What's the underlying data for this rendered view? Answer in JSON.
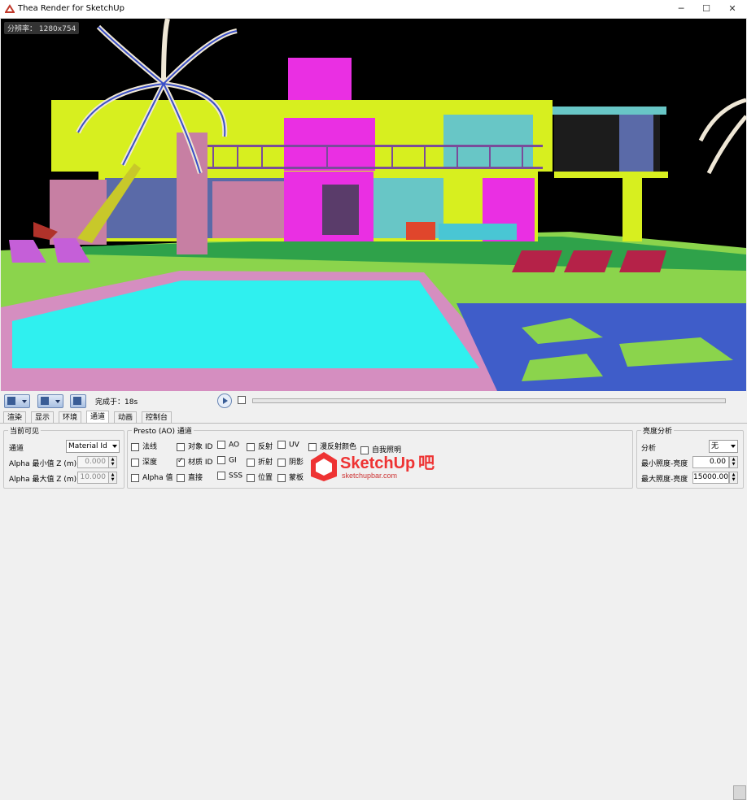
{
  "window": {
    "title": "Thea Render for SketchUp",
    "minimize": "─",
    "maximize": "☐",
    "close": "✕"
  },
  "viewport": {
    "resolution": "分辨率： 1280x754"
  },
  "toolbar": {
    "status": "完成于：18s"
  },
  "tabs": [
    "渲染",
    "显示",
    "环境",
    "通道",
    "动画",
    "控制台"
  ],
  "active_tab": "通道",
  "current_visible": {
    "title": "当前可见",
    "channel_label": "通道",
    "channel_value": "Material Id",
    "alpha_min_label": "Alpha 最小值 Z (m)",
    "alpha_min_value": "0.000",
    "alpha_max_label": "Alpha 最大值 Z (m)",
    "alpha_max_value": "10.000"
  },
  "presto": {
    "title": "Presto (AO) 通道",
    "checkboxes": [
      {
        "label": "法线",
        "checked": false
      },
      {
        "label": "对象 ID",
        "checked": false
      },
      {
        "label": "AO",
        "checked": false
      },
      {
        "label": "反射",
        "checked": false
      },
      {
        "label": "UV",
        "checked": false
      },
      {
        "label": "漫反射颜色",
        "checked": false
      },
      {
        "label": "深度",
        "checked": false
      },
      {
        "label": "材质 ID",
        "checked": true
      },
      {
        "label": "GI",
        "checked": false
      },
      {
        "label": "折射",
        "checked": false
      },
      {
        "label": "阴影",
        "checked": false
      },
      {
        "label": "Alpha 值",
        "checked": false
      },
      {
        "label": "直接",
        "checked": false
      },
      {
        "label": "SSS",
        "checked": false
      },
      {
        "label": "位置",
        "checked": false
      },
      {
        "label": "蒙板",
        "checked": false
      }
    ],
    "extra_label": "自我照明"
  },
  "brightness": {
    "title": "亮度分析",
    "analysis_label": "分析",
    "analysis_value": "无",
    "min_label": "最小照度-亮度",
    "min_value": "0.00",
    "max_label": "最大照度-亮度",
    "max_value": "15000.00"
  },
  "watermark": {
    "brand": "SketchUp",
    "suffix": "吧",
    "url": "sketchupbar.com"
  },
  "colors": {
    "sky": "#000000",
    "house_yellow": "#d7ef1f",
    "magenta": "#ea2fe3",
    "pool": "#2ff0ef",
    "pool_edge": "#d58ec0",
    "grass": "#8bd44c",
    "water": "#3f5dc9"
  }
}
